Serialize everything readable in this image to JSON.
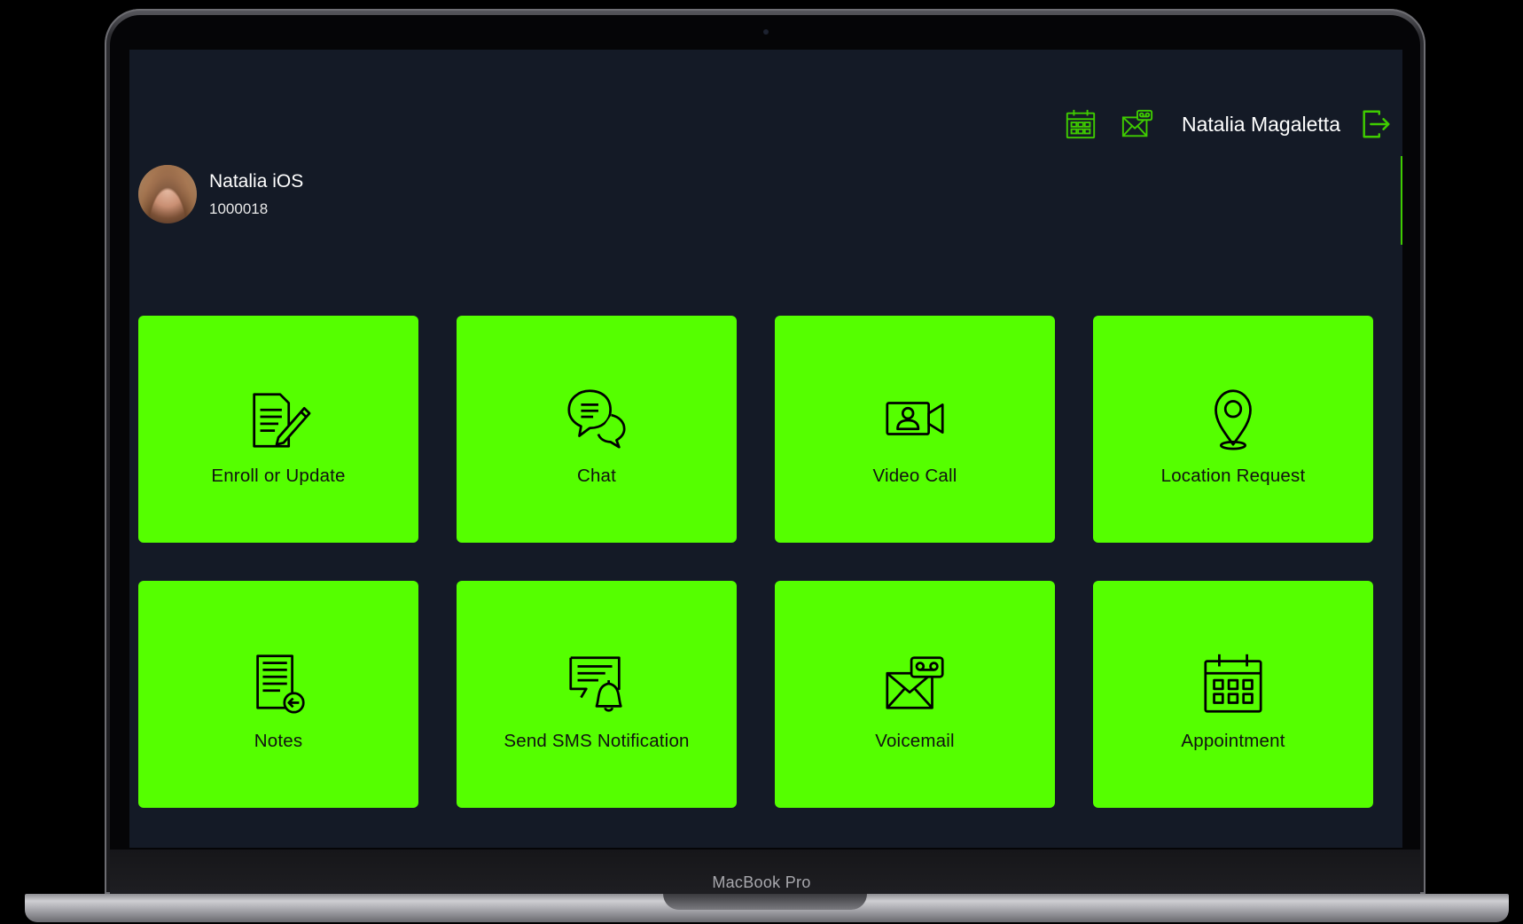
{
  "device": {
    "label": "MacBook Pro"
  },
  "header": {
    "user_name": "Natalia Magaletta",
    "icons": [
      "calendar-icon",
      "voicemail-icon",
      "logout-icon"
    ]
  },
  "profile": {
    "name": "Natalia iOS",
    "id": "1000018"
  },
  "tiles": [
    {
      "label": "Enroll or Update",
      "icon": "document-edit-icon"
    },
    {
      "label": "Chat",
      "icon": "chat-icon"
    },
    {
      "label": "Video Call",
      "icon": "video-call-icon"
    },
    {
      "label": "Location Request",
      "icon": "location-pin-icon"
    },
    {
      "label": "Notes",
      "icon": "notes-icon"
    },
    {
      "label": "Send SMS Notification",
      "icon": "sms-bell-icon"
    },
    {
      "label": "Voicemail",
      "icon": "voicemail-icon"
    },
    {
      "label": "Appointment",
      "icon": "calendar-icon"
    }
  ],
  "colors": {
    "accent": "#55ff00",
    "icon_accent": "#3fcc00",
    "background": "#141a26",
    "text": "#ffffff",
    "tile_text": "#111111"
  }
}
